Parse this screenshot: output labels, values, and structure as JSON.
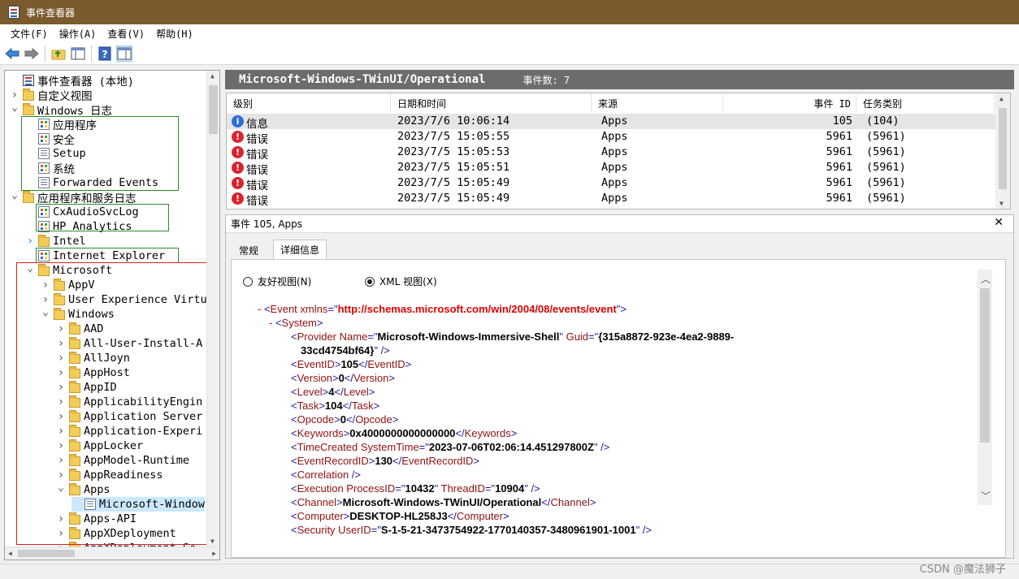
{
  "window": {
    "title": "事件查看器"
  },
  "menu": [
    "文件(F)",
    "操作(A)",
    "查看(V)",
    "帮助(H)"
  ],
  "tree": {
    "items": [
      {
        "label": "事件查看器 (本地)",
        "icon": "root",
        "indent": 0,
        "arrow": ""
      },
      {
        "label": "自定义视图",
        "icon": "folder",
        "indent": 0,
        "arrow": "collapsed"
      },
      {
        "label": "Windows 日志",
        "icon": "folder",
        "indent": 0,
        "arrow": "expanded"
      },
      {
        "label": "应用程序",
        "icon": "appl",
        "indent": 1,
        "arrow": ""
      },
      {
        "label": "安全",
        "icon": "appl",
        "indent": 1,
        "arrow": ""
      },
      {
        "label": "Setup",
        "icon": "log",
        "indent": 1,
        "arrow": ""
      },
      {
        "label": "系统",
        "icon": "appl",
        "indent": 1,
        "arrow": ""
      },
      {
        "label": "Forwarded Events",
        "icon": "log",
        "indent": 1,
        "arrow": ""
      },
      {
        "label": "应用程序和服务日志",
        "icon": "folder",
        "indent": 0,
        "arrow": "expanded"
      },
      {
        "label": "CxAudioSvcLog",
        "icon": "appl",
        "indent": 1,
        "arrow": ""
      },
      {
        "label": "HP Analytics",
        "icon": "appl",
        "indent": 1,
        "arrow": ""
      },
      {
        "label": "Intel",
        "icon": "folder",
        "indent": 1,
        "arrow": "collapsed-blue"
      },
      {
        "label": "Internet Explorer",
        "icon": "appl",
        "indent": 1,
        "arrow": ""
      },
      {
        "label": "Microsoft",
        "icon": "folder",
        "indent": 1,
        "arrow": "expanded"
      },
      {
        "label": "AppV",
        "icon": "folder",
        "indent": 2,
        "arrow": "collapsed"
      },
      {
        "label": "User Experience Virtu",
        "icon": "folder",
        "indent": 2,
        "arrow": "collapsed"
      },
      {
        "label": "Windows",
        "icon": "folder",
        "indent": 2,
        "arrow": "expanded"
      },
      {
        "label": "AAD",
        "icon": "folder",
        "indent": 3,
        "arrow": "collapsed"
      },
      {
        "label": "All-User-Install-A",
        "icon": "folder",
        "indent": 3,
        "arrow": "collapsed"
      },
      {
        "label": "AllJoyn",
        "icon": "folder",
        "indent": 3,
        "arrow": "collapsed"
      },
      {
        "label": "AppHost",
        "icon": "folder",
        "indent": 3,
        "arrow": "collapsed"
      },
      {
        "label": "AppID",
        "icon": "folder",
        "indent": 3,
        "arrow": "collapsed"
      },
      {
        "label": "ApplicabilityEngin",
        "icon": "folder",
        "indent": 3,
        "arrow": "collapsed"
      },
      {
        "label": "Application Server",
        "icon": "folder",
        "indent": 3,
        "arrow": "collapsed"
      },
      {
        "label": "Application-Experi",
        "icon": "folder",
        "indent": 3,
        "arrow": "collapsed"
      },
      {
        "label": "AppLocker",
        "icon": "folder",
        "indent": 3,
        "arrow": "collapsed"
      },
      {
        "label": "AppModel-Runtime",
        "icon": "folder",
        "indent": 3,
        "arrow": "collapsed"
      },
      {
        "label": "AppReadiness",
        "icon": "folder",
        "indent": 3,
        "arrow": "collapsed"
      },
      {
        "label": "Apps",
        "icon": "folder",
        "indent": 3,
        "arrow": "expanded"
      },
      {
        "label": "Microsoft-Window",
        "icon": "log",
        "indent": 4,
        "arrow": "",
        "selected": true
      },
      {
        "label": "Apps-API",
        "icon": "folder",
        "indent": 3,
        "arrow": "collapsed"
      },
      {
        "label": "AppXDeployment",
        "icon": "folder",
        "indent": 3,
        "arrow": "collapsed"
      },
      {
        "label": "AppXDeployment-Se",
        "icon": "folder",
        "indent": 3,
        "arrow": "collapsed"
      }
    ]
  },
  "log_header": {
    "name": "Microsoft-Windows-TWinUI/Operational",
    "count": "事件数: 7"
  },
  "event_list": {
    "columns": [
      "级别",
      "日期和时间",
      "来源",
      "事件 ID",
      "任务类别"
    ],
    "rows": [
      {
        "level": "信息",
        "level_type": "info",
        "datetime": "2023/7/6 10:06:14",
        "source": "Apps",
        "id": "105",
        "task": "(104)",
        "selected": true
      },
      {
        "level": "错误",
        "level_type": "error",
        "datetime": "2023/7/5 15:05:55",
        "source": "Apps",
        "id": "5961",
        "task": "(5961)"
      },
      {
        "level": "错误",
        "level_type": "error",
        "datetime": "2023/7/5 15:05:53",
        "source": "Apps",
        "id": "5961",
        "task": "(5961)"
      },
      {
        "level": "错误",
        "level_type": "error",
        "datetime": "2023/7/5 15:05:51",
        "source": "Apps",
        "id": "5961",
        "task": "(5961)"
      },
      {
        "level": "错误",
        "level_type": "error",
        "datetime": "2023/7/5 15:05:49",
        "source": "Apps",
        "id": "5961",
        "task": "(5961)"
      },
      {
        "level": "错误",
        "level_type": "error",
        "datetime": "2023/7/5 15:05:49",
        "source": "Apps",
        "id": "5961",
        "task": "(5961)"
      }
    ]
  },
  "details": {
    "title": "事件 105, Apps",
    "tabs": [
      "常规",
      "详细信息"
    ],
    "active_tab": "详细信息",
    "view_options": [
      "友好视图(N)",
      "XML 视图(X)"
    ],
    "selected_view": "XML 视图(X)",
    "xml_lines": [
      {
        "indent": 0,
        "html": "<span class=\"red\">- </span><span class=\"br\">&lt;</span><span class=\"tag\">Event </span><span class=\"atn\">xmlns</span><span class=\"br\">=\"</span><span class=\"redb\">http://schemas.microsoft.com/win/2004/08/events/event</span><span class=\"br\">\"&gt;</span>"
      },
      {
        "indent": 1,
        "html": "<span class=\"red\">- </span><span class=\"br\">&lt;</span><span class=\"tag\">System</span><span class=\"br\">&gt;</span>"
      },
      {
        "indent": 2,
        "html": "<span class=\"br\">&lt;</span><span class=\"tag\">Provider </span><span class=\"atn\">Name</span><span class=\"br\">=\"</span><span class=\"aval\">Microsoft-Windows-Immersive-Shell</span><span class=\"br\">\" </span><span class=\"atn\">Guid</span><span class=\"br\">=\"</span><span class=\"aval\">{315a8872-923e-4ea2-9889-</span>"
      },
      {
        "indent": 3,
        "html": "<span class=\"aval\">33cd4754bf64}</span><span class=\"br\">\" /&gt;</span>"
      },
      {
        "indent": 2,
        "html": "<span class=\"br\">&lt;</span><span class=\"tag\">EventID</span><span class=\"br\">&gt;</span><span class=\"val\">105</span><span class=\"br\">&lt;/</span><span class=\"tag\">EventID</span><span class=\"br\">&gt;</span>"
      },
      {
        "indent": 2,
        "html": "<span class=\"br\">&lt;</span><span class=\"tag\">Version</span><span class=\"br\">&gt;</span><span class=\"val\">0</span><span class=\"br\">&lt;/</span><span class=\"tag\">Version</span><span class=\"br\">&gt;</span>"
      },
      {
        "indent": 2,
        "html": "<span class=\"br\">&lt;</span><span class=\"tag\">Level</span><span class=\"br\">&gt;</span><span class=\"val\">4</span><span class=\"br\">&lt;/</span><span class=\"tag\">Level</span><span class=\"br\">&gt;</span>"
      },
      {
        "indent": 2,
        "html": "<span class=\"br\">&lt;</span><span class=\"tag\">Task</span><span class=\"br\">&gt;</span><span class=\"val\">104</span><span class=\"br\">&lt;/</span><span class=\"tag\">Task</span><span class=\"br\">&gt;</span>"
      },
      {
        "indent": 2,
        "html": "<span class=\"br\">&lt;</span><span class=\"tag\">Opcode</span><span class=\"br\">&gt;</span><span class=\"val\">0</span><span class=\"br\">&lt;/</span><span class=\"tag\">Opcode</span><span class=\"br\">&gt;</span>"
      },
      {
        "indent": 2,
        "html": "<span class=\"br\">&lt;</span><span class=\"tag\">Keywords</span><span class=\"br\">&gt;</span><span class=\"val\">0x4000000000000000</span><span class=\"br\">&lt;/</span><span class=\"tag\">Keywords</span><span class=\"br\">&gt;</span>"
      },
      {
        "indent": 2,
        "html": "<span class=\"br\">&lt;</span><span class=\"tag\">TimeCreated </span><span class=\"atn\">SystemTime</span><span class=\"br\">=\"</span><span class=\"aval\">2023-07-06T02:06:14.451297800Z</span><span class=\"br\">\" /&gt;</span>"
      },
      {
        "indent": 2,
        "html": "<span class=\"br\">&lt;</span><span class=\"tag\">EventRecordID</span><span class=\"br\">&gt;</span><span class=\"val\">130</span><span class=\"br\">&lt;/</span><span class=\"tag\">EventRecordID</span><span class=\"br\">&gt;</span>"
      },
      {
        "indent": 2,
        "html": "<span class=\"br\">&lt;</span><span class=\"tag\">Correlation </span><span class=\"br\">/&gt;</span>"
      },
      {
        "indent": 2,
        "html": "<span class=\"br\">&lt;</span><span class=\"tag\">Execution </span><span class=\"atn\">ProcessID</span><span class=\"br\">=\"</span><span class=\"aval\">10432</span><span class=\"br\">\" </span><span class=\"atn\">ThreadID</span><span class=\"br\">=\"</span><span class=\"aval\">10904</span><span class=\"br\">\" /&gt;</span>"
      },
      {
        "indent": 2,
        "html": "<span class=\"br\">&lt;</span><span class=\"tag\">Channel</span><span class=\"br\">&gt;</span><span class=\"val\">Microsoft-Windows-TWinUI/Operational</span><span class=\"br\">&lt;/</span><span class=\"tag\">Channel</span><span class=\"br\">&gt;</span>"
      },
      {
        "indent": 2,
        "html": "<span class=\"br\">&lt;</span><span class=\"tag\">Computer</span><span class=\"br\">&gt;</span><span class=\"val\">DESKTOP-HL258J3</span><span class=\"br\">&lt;/</span><span class=\"tag\">Computer</span><span class=\"br\">&gt;</span>"
      },
      {
        "indent": 2,
        "html": "<span class=\"br\">&lt;</span><span class=\"tag\">Security </span><span class=\"atn\">UserID</span><span class=\"br\">=\"</span><span class=\"aval\">S-1-5-21-3473754922-1770140357-3480961901-1001</span><span class=\"br\">\" /&gt;</span>"
      }
    ]
  },
  "watermark": "CSDN @魔法狮子",
  "colors": {
    "titlebar": "#7b5a2e",
    "header_bar": "#6c6c6c",
    "annot_green": "#2a8a2a",
    "annot_red": "#d82020"
  }
}
